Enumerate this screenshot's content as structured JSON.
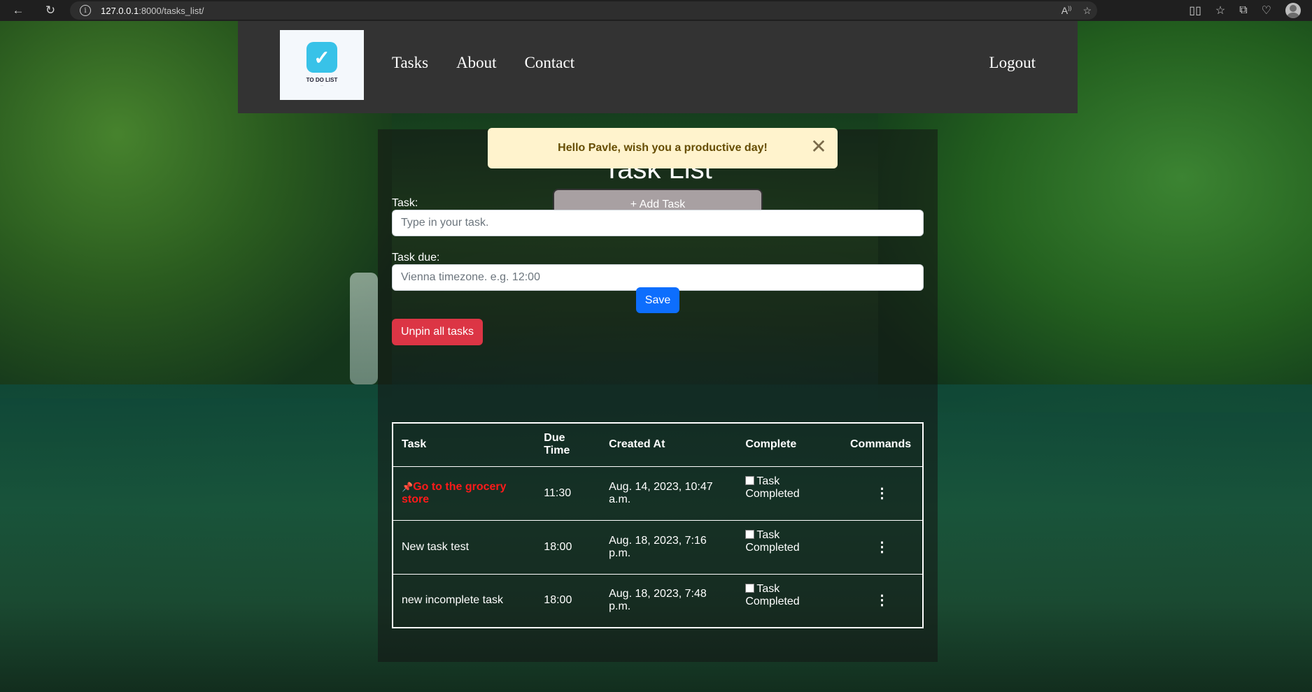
{
  "browser": {
    "url_host": "127.0.0.1",
    "url_path": ":8000/tasks_list/"
  },
  "header": {
    "logo_text": "TO DO LIST",
    "nav": [
      "Tasks",
      "About",
      "Contact"
    ],
    "logout": "Logout"
  },
  "alert": {
    "message": "Hello Pavle, wish you a productive day!",
    "close_glyph": "✕"
  },
  "main": {
    "title": "Task List",
    "add_task": "+ Add Task",
    "task_label": "Task:",
    "task_placeholder": "Type in your task.",
    "due_label": "Task due:",
    "due_placeholder": "Vienna timezone. e.g. 12:00",
    "save": "Save",
    "unpin_all": "Unpin all tasks"
  },
  "table": {
    "headers": {
      "task": "Task",
      "due_time": "Due Time",
      "created_at": "Created At",
      "complete": "Complete",
      "commands": "Commands"
    },
    "rows": [
      {
        "task": "Go to the grocery store",
        "pinned": true,
        "due": "11:30",
        "created": "Aug. 14, 2023, 10:47 a.m.",
        "complete_label": "Task Completed"
      },
      {
        "task": "New task test",
        "pinned": false,
        "due": "18:00",
        "created": "Aug. 18, 2023, 7:16 p.m.",
        "complete_label": "Task Completed"
      },
      {
        "task": "new incomplete task",
        "pinned": false,
        "due": "18:00",
        "created": "Aug. 18, 2023, 7:48 p.m.",
        "complete_label": "Task Completed"
      }
    ]
  },
  "colors": {
    "alert_bg": "#fff3cd",
    "save_button": "#0d6efd",
    "unpin_button": "#dc3545",
    "pinned_text": "#ff1a1a"
  }
}
